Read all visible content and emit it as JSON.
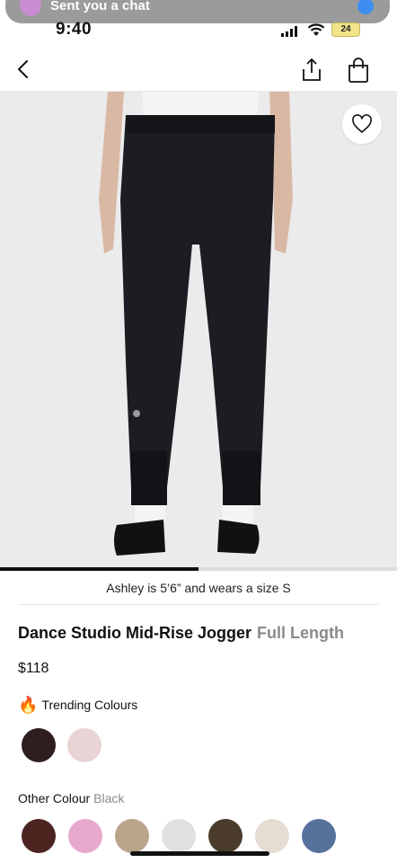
{
  "status_bar": {
    "time": "9:40",
    "battery": "24"
  },
  "notification_banner": {
    "text": "Sent you a chat"
  },
  "product": {
    "model_note": "Ashley is 5’6” and wears a size S",
    "name": "Dance Studio Mid-Rise Jogger",
    "length": "Full Length",
    "price": "$118"
  },
  "trending": {
    "label": "Trending Colours",
    "icon": "fire-icon",
    "colors": [
      "#2f1e1f",
      "#ead3d4"
    ]
  },
  "other_colour": {
    "label": "Other Colour",
    "selected": "Black",
    "colors": [
      "#4b2420",
      "#e6a9cd",
      "#b8a58a",
      "#dfe0e1",
      "#4a3b2d",
      "#e6ddd2",
      "#55719c"
    ]
  },
  "gallery": {
    "progress": 0.5
  },
  "colors": {
    "image_bg": "#ebebec",
    "accent": "#111111",
    "muted": "#8a8a8a"
  }
}
